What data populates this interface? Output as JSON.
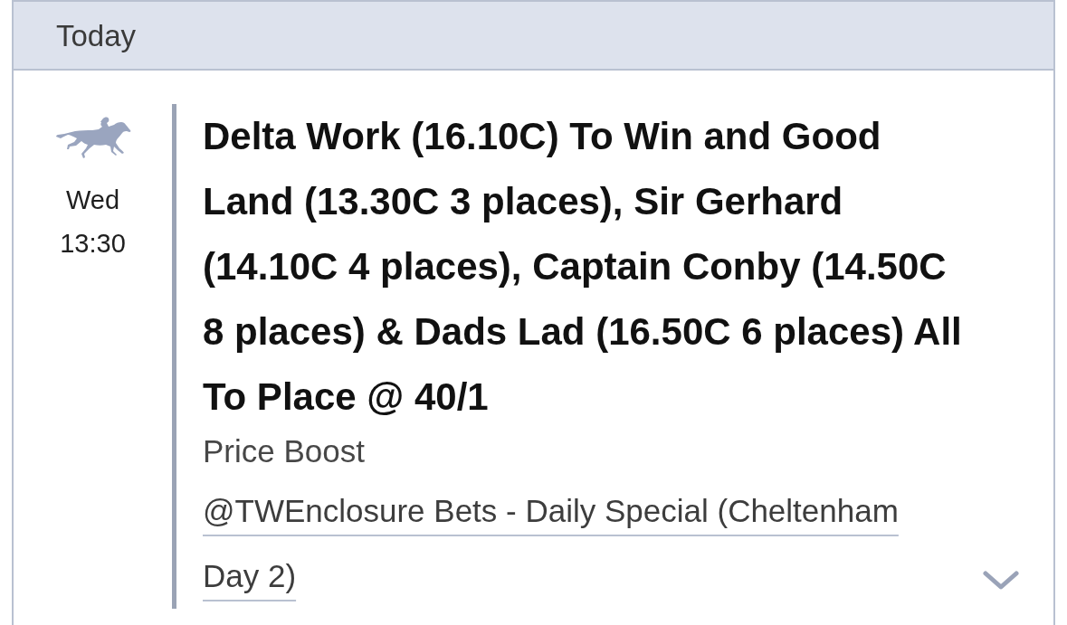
{
  "header": {
    "title": "Today"
  },
  "bets": [
    {
      "day": "Wed",
      "time": "13:30",
      "title": "Delta Work (16.10C) To Win and Good Land (13.30C 3 places), Sir Gerhard (14.10C 4 places), Captain Conby (14.50C 8 places) & Dads Lad (16.50C 6 places) All To Place @ 40/1",
      "type_label": "Price Boost",
      "source_link": "@TWEnclosure Bets - Daily Special (Cheltenham Day 2)",
      "expanded": false
    }
  ]
}
